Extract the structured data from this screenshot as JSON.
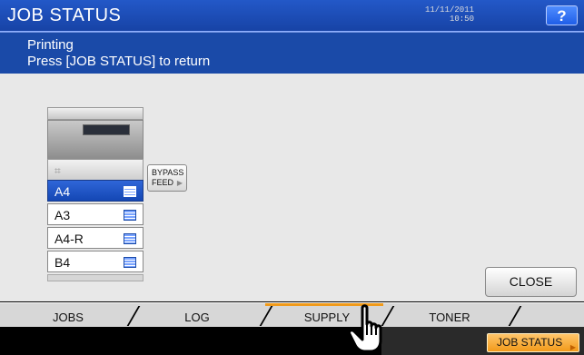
{
  "header": {
    "title": "JOB STATUS",
    "help_label": "?"
  },
  "message": {
    "line1": "Printing",
    "line2": "Press [JOB STATUS] to return"
  },
  "device": {
    "bypass_label_line1": "BYPASS",
    "bypass_label_line2": "FEED",
    "trays": [
      {
        "label": "A4",
        "selected": true
      },
      {
        "label": "A3",
        "selected": false
      },
      {
        "label": "A4-R",
        "selected": false
      },
      {
        "label": "B4",
        "selected": false
      }
    ]
  },
  "buttons": {
    "close_label": "CLOSE"
  },
  "tabs": {
    "jobs": "JOBS",
    "log": "LOG",
    "supply": "SUPPLY",
    "toner": "TONER",
    "active": "SUPPLY"
  },
  "status": {
    "date": "11/11/2011",
    "time": "10:50",
    "job_status_label": "JOB STATUS"
  },
  "colors": {
    "title_bar": "#1f4fb8",
    "selected_tray": "#1f5ad0",
    "active_tab_accent": "#f09a1a",
    "job_status_button": "#f5a623"
  },
  "icons": {
    "help": "question-icon",
    "pointer": "hand-pointer-icon",
    "tray": "paper-stack-icon"
  }
}
